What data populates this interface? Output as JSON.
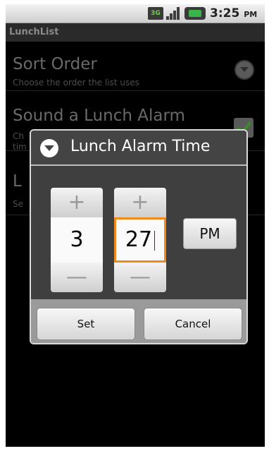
{
  "status_bar": {
    "network_label": "3G",
    "time": "3:25",
    "ampm": "PM"
  },
  "app": {
    "title": "LunchList"
  },
  "preferences": [
    {
      "title": "Sort Order",
      "summary": "Choose the order the list uses",
      "widget": "dropdown"
    },
    {
      "title": "Sound a Lunch Alarm",
      "summary": "Ch",
      "summary2": "tim",
      "widget": "checkbox",
      "checked": true
    },
    {
      "title": "L",
      "summary": "Se",
      "widget": "none"
    }
  ],
  "dialog": {
    "title": "Lunch Alarm Time",
    "hour": {
      "value": "3",
      "increment": "+",
      "decrement": "—"
    },
    "minute": {
      "value": "27",
      "increment": "+",
      "decrement": "—"
    },
    "ampm_button": "PM",
    "buttons": {
      "set": "Set",
      "cancel": "Cancel"
    }
  }
}
